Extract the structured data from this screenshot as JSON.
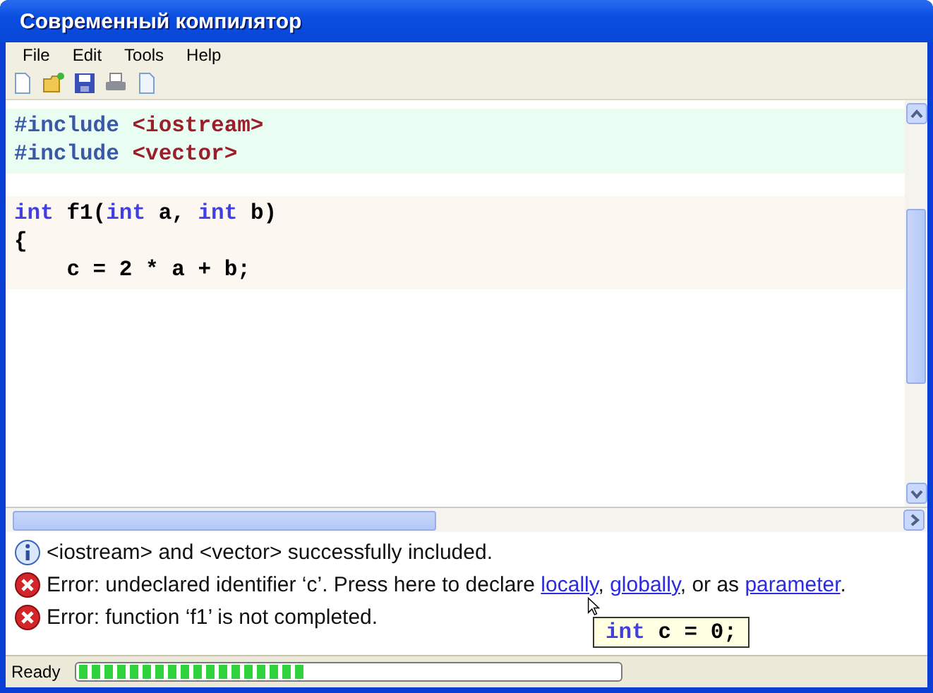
{
  "window": {
    "title": "Современный компилятор"
  },
  "menu": [
    "File",
    "Edit",
    "Tools",
    "Help"
  ],
  "code_blocks": [
    {
      "kind": "includes",
      "lines": [
        [
          {
            "kind": "directive",
            "text": "#include"
          },
          {
            "kind": "header",
            "text": "<iostream>"
          }
        ],
        [
          {
            "kind": "directive",
            "text": "#include"
          },
          {
            "kind": "header",
            "text": "<vector>"
          }
        ]
      ]
    },
    {
      "kind": "function",
      "lines": [
        [
          {
            "kind": "keyword",
            "text": "int"
          },
          {
            "kind": "plain",
            "text": " f1("
          },
          {
            "kind": "keyword",
            "text": "int"
          },
          {
            "kind": "plain",
            "text": " a, "
          },
          {
            "kind": "keyword",
            "text": "int"
          },
          {
            "kind": "plain",
            "text": " b)"
          }
        ],
        [
          {
            "kind": "plain",
            "text": "{"
          }
        ],
        [
          {
            "kind": "plain",
            "text": "    c = 2 * a + b;"
          }
        ]
      ]
    }
  ],
  "messages": [
    {
      "kind": "info",
      "parts": [
        {
          "kind": "text",
          "text": "<iostream> and <vector> successfully included."
        }
      ]
    },
    {
      "kind": "error",
      "parts": [
        {
          "kind": "text",
          "text": "Error: undeclared identifier ‘c’. Press here to declare "
        },
        {
          "kind": "link",
          "text": "locally"
        },
        {
          "kind": "text",
          "text": ", "
        },
        {
          "kind": "link",
          "text": "globally"
        },
        {
          "kind": "text",
          "text": ", or as "
        },
        {
          "kind": "link",
          "text": "parameter"
        },
        {
          "kind": "text",
          "text": "."
        }
      ]
    },
    {
      "kind": "error",
      "parts": [
        {
          "kind": "text",
          "text": "Error: function ‘f1’ is not completed."
        }
      ]
    }
  ],
  "tooltip": [
    {
      "kind": "keyword",
      "text": "int"
    },
    {
      "kind": "plain",
      "text": " c = 0;"
    }
  ],
  "status_bar": {
    "text": "Ready",
    "progress": {
      "level": 0.42
    }
  }
}
